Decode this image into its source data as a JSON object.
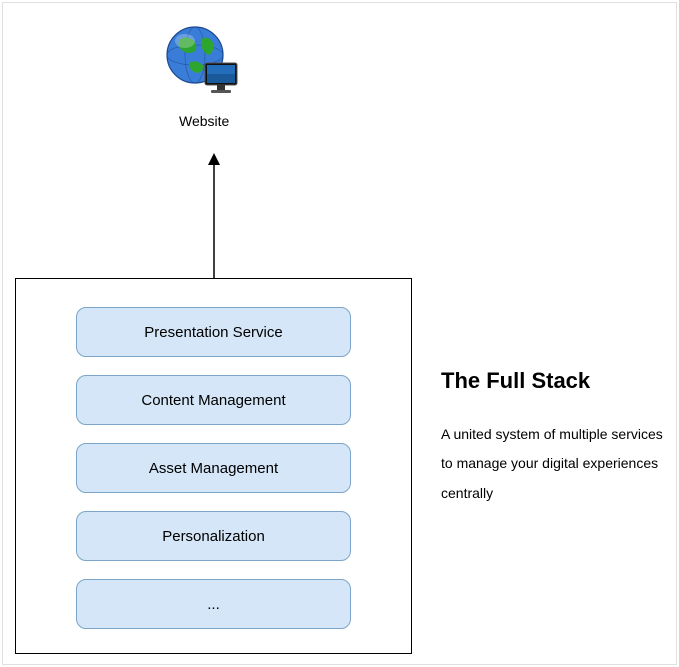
{
  "consumer": {
    "label": "Website",
    "icon": "globe-monitor-icon"
  },
  "stack": {
    "items": [
      {
        "label": "Presentation Service"
      },
      {
        "label": "Content Management"
      },
      {
        "label": "Asset Management"
      },
      {
        "label": "Personalization"
      },
      {
        "label": "..."
      }
    ]
  },
  "aside": {
    "title": "The Full Stack",
    "description": "A united system of multiple services to manage your digital experiences centrally"
  },
  "colors": {
    "box_fill": "#d4e6f7",
    "box_border": "#7ca5c9"
  }
}
